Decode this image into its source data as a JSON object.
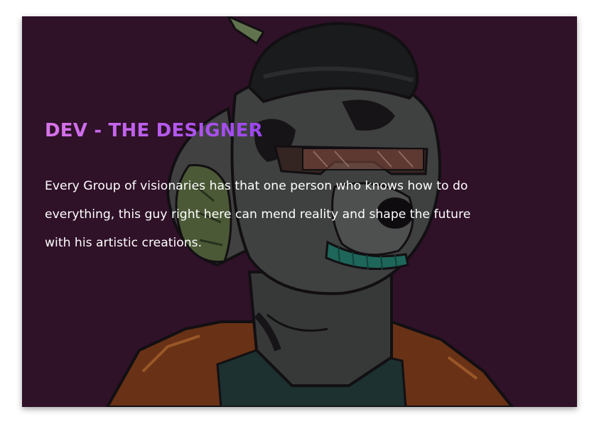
{
  "hero": {
    "title": "DEV - THE DESIGNER",
    "description": "Every Group of visionaries has that one person who knows how to do everything, this guy right here can mend reality and shape the future with his artistic creations.",
    "image_subject": "dog-character-portrait",
    "colors": {
      "background": "#34132b",
      "title_gradient_start": "#d974ea",
      "title_gradient_end": "#9a45ef",
      "text": "#ffffff"
    }
  }
}
